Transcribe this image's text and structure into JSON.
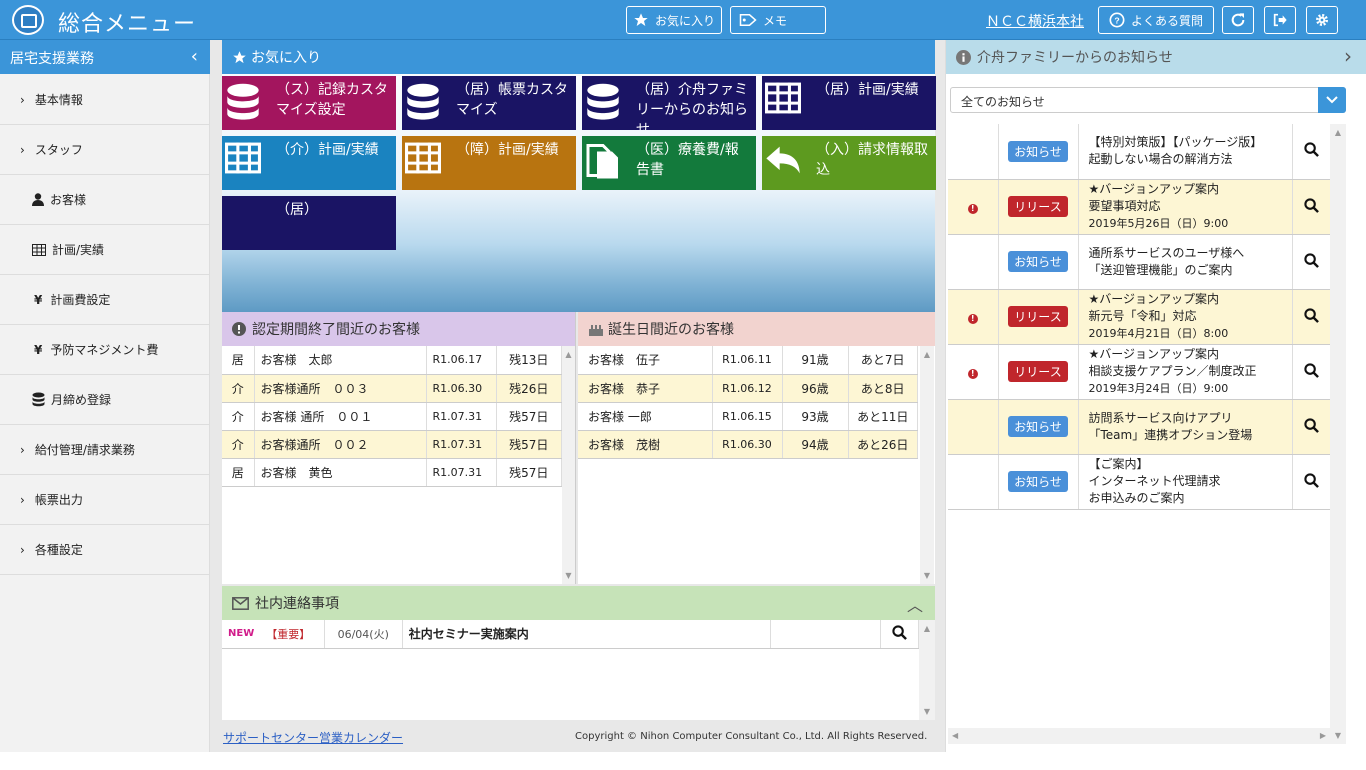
{
  "header": {
    "title": "総合メニュー",
    "favorites_label": "お気に入り",
    "memo_label": "メモ",
    "company": "ＮＣＣ横浜本社",
    "faq_label": "よくある質問"
  },
  "sidebar": {
    "title": "居宅支援業務",
    "items": [
      {
        "label": "基本情報",
        "icon": "chevron-right-icon"
      },
      {
        "label": "スタッフ",
        "icon": "chevron-right-icon"
      },
      {
        "label": "お客様",
        "icon": "person-icon"
      },
      {
        "label": "計画/実績",
        "icon": "table-icon"
      },
      {
        "label": "計画費設定",
        "icon": "yen-icon"
      },
      {
        "label": "予防マネジメント費",
        "icon": "yen-icon"
      },
      {
        "label": "月締め登録",
        "icon": "database-icon"
      },
      {
        "label": "給付管理/請求業務",
        "icon": "chevron-right-icon"
      },
      {
        "label": "帳票出力",
        "icon": "chevron-right-icon"
      },
      {
        "label": "各種設定",
        "icon": "chevron-right-icon"
      }
    ]
  },
  "favorites": {
    "title": "お気に入り",
    "tiles": [
      {
        "label": "（ス）記録カスタマイズ設定",
        "color": "#a3155e",
        "icon": "database-icon"
      },
      {
        "label": "（居）帳票カスタマイズ",
        "color": "#1a1464",
        "icon": "database-icon"
      },
      {
        "label": "（居）介舟ファミリーからのお知らせ",
        "color": "#1a1464",
        "icon": "database-icon"
      },
      {
        "label": "（居）計画/実績",
        "color": "#1a1464",
        "icon": "table-icon"
      },
      {
        "label": "（介）計画/実績",
        "color": "#1a83c0",
        "icon": "table-icon"
      },
      {
        "label": "（障）計画/実績",
        "color": "#b87410",
        "icon": "table-icon"
      },
      {
        "label": "（医）療養費/報告書",
        "color": "#137a3c",
        "icon": "document-icon"
      },
      {
        "label": "（入）請求情報取込",
        "color": "#5d9a1f",
        "icon": "reply-icon"
      },
      {
        "label": "（居）",
        "color": "#1a1464",
        "icon": "none"
      }
    ]
  },
  "expiring": {
    "title": "認定期間終了間近のお客様",
    "rows": [
      {
        "type": "居",
        "name": "お客様　太郎",
        "date": "R1.06.17",
        "remain": "残13日"
      },
      {
        "type": "介",
        "name": "お客様通所　００３",
        "date": "R1.06.30",
        "remain": "残26日"
      },
      {
        "type": "介",
        "name": "お客様 通所　００１",
        "date": "R1.07.31",
        "remain": "残57日"
      },
      {
        "type": "介",
        "name": "お客様通所　００２",
        "date": "R1.07.31",
        "remain": "残57日"
      },
      {
        "type": "居",
        "name": "お客様　黄色",
        "date": "R1.07.31",
        "remain": "残57日"
      }
    ]
  },
  "birthday": {
    "title": "誕生日間近のお客様",
    "rows": [
      {
        "name": "お客様　伍子",
        "date": "R1.06.11",
        "age": "91歳",
        "remain": "あと7日"
      },
      {
        "name": "お客様　恭子",
        "date": "R1.06.12",
        "age": "96歳",
        "remain": "あと8日"
      },
      {
        "name": "お客様 一郎",
        "date": "R1.06.15",
        "age": "93歳",
        "remain": "あと11日"
      },
      {
        "name": "お客様　茂樹",
        "date": "R1.06.30",
        "age": "94歳",
        "remain": "あと26日"
      }
    ]
  },
  "internal": {
    "title": "社内連絡事項",
    "rows": [
      {
        "new": "NEW",
        "priority": "【重要】",
        "date": "06/04(火)",
        "subject": "社内セミナー実施案内"
      }
    ]
  },
  "footer": {
    "calendar_link": "サポートセンター営業カレンダー",
    "copyright": "Copyright © Nihon Computer Consultant Co., Ltd. All Rights Reserved."
  },
  "notices": {
    "title": "介舟ファミリーからのお知らせ",
    "filter_value": "全てのお知らせ",
    "rows": [
      {
        "important": false,
        "badge": "お知らせ",
        "badge_type": "info",
        "lines": [
          "【特別対策版】【パッケージ版】",
          "起動しない場合の解消方法",
          ""
        ]
      },
      {
        "important": true,
        "badge": "リリース",
        "badge_type": "release",
        "lines": [
          "★バージョンアップ案内",
          "要望事項対応",
          "2019年5月26日（日）9:00"
        ]
      },
      {
        "important": false,
        "badge": "お知らせ",
        "badge_type": "info",
        "lines": [
          "通所系サービスのユーザ様へ",
          "「送迎管理機能」のご案内",
          ""
        ]
      },
      {
        "important": true,
        "badge": "リリース",
        "badge_type": "release",
        "lines": [
          "★バージョンアップ案内",
          "新元号「令和」対応",
          "2019年4月21日（日）8:00"
        ]
      },
      {
        "important": true,
        "badge": "リリース",
        "badge_type": "release",
        "lines": [
          "★バージョンアップ案内",
          "相談支援ケアプラン／制度改正",
          "2019年3月24日（日）9:00"
        ]
      },
      {
        "important": false,
        "badge": "お知らせ",
        "badge_type": "info",
        "lines": [
          "訪問系サービス向けアプリ",
          "「Team」連携オプション登場",
          ""
        ]
      },
      {
        "important": false,
        "badge": "お知らせ",
        "badge_type": "info",
        "lines": [
          "【ご案内】",
          "インターネット代理請求",
          "お申込みのご案内"
        ]
      }
    ]
  }
}
